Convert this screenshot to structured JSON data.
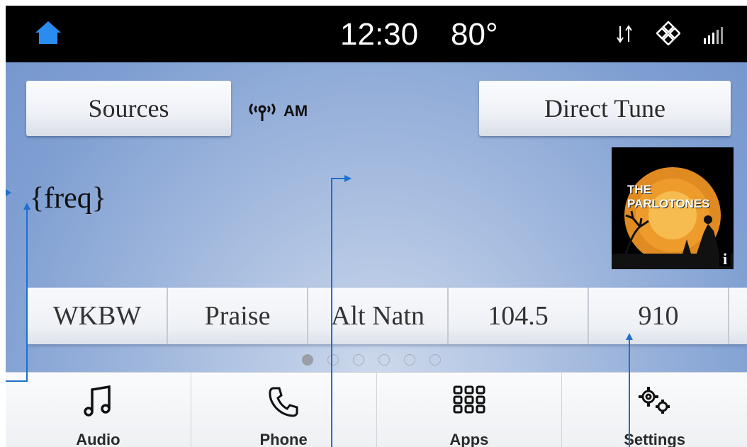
{
  "status_bar": {
    "home_icon": "home-icon",
    "time": "12:30",
    "temperature": "80°",
    "icons": [
      "data-transfer-icon",
      "climate-icon",
      "signal-strength-icon"
    ]
  },
  "radio": {
    "sources_label": "Sources",
    "band_icon": "antenna-icon",
    "band": "AM",
    "direct_tune_label": "Direct Tune",
    "frequency": "{freq}",
    "album_art": {
      "icon": "album-art",
      "title": "THE PARLOTONES",
      "info_badge": "i"
    }
  },
  "presets": [
    {
      "label": "WKBW"
    },
    {
      "label": "Praise"
    },
    {
      "label": "Alt Natn"
    },
    {
      "label": "104.5"
    },
    {
      "label": "910"
    }
  ],
  "page_indicator": {
    "pages": 6,
    "active": 1
  },
  "nav": [
    {
      "label": "Audio",
      "icon": "music-note-icon"
    },
    {
      "label": "Phone",
      "icon": "phone-icon"
    },
    {
      "label": "Apps",
      "icon": "apps-grid-icon"
    },
    {
      "label": "Settings",
      "icon": "gears-icon"
    }
  ],
  "colors": {
    "accent_blue": "#2a8cf0",
    "annotation_line": "#1f6fd0",
    "status_bar": "#000000"
  }
}
